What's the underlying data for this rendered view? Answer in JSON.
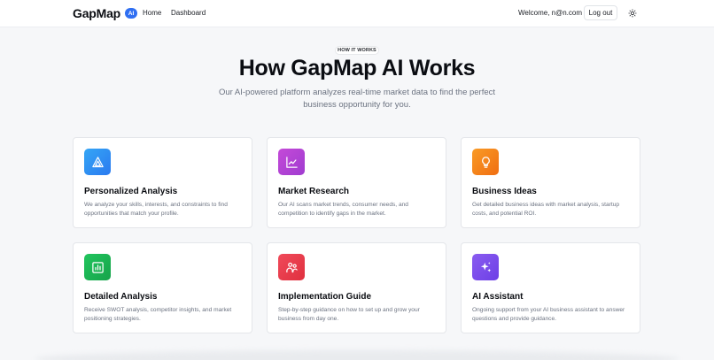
{
  "nav": {
    "brand": "GapMap",
    "badge": "AI",
    "links": [
      "Home",
      "Dashboard"
    ],
    "welcome": "Welcome, n@n.com",
    "logout": "Log out",
    "theme_icon": "sun-icon"
  },
  "hero": {
    "pill": "HOW IT WORKS",
    "title": "How GapMap AI Works",
    "subtitle": "Our AI-powered platform analyzes real-time market data to find the perfect business opportunity for you."
  },
  "cards": [
    {
      "title": "Personalized Analysis",
      "desc": "We analyze your skills, interests, and constraints to find opportunities that match your profile.",
      "icon": "triangle-icon",
      "color_from": "#35a6f5",
      "color_to": "#2a7af0"
    },
    {
      "title": "Market Research",
      "desc": "Our AI scans market trends, consumer needs, and competition to identify gaps in the market.",
      "icon": "line-chart-icon",
      "color_from": "#c44ad8",
      "color_to": "#a03cd0"
    },
    {
      "title": "Business Ideas",
      "desc": "Get detailed business ideas with market analysis, startup costs, and potential ROI.",
      "icon": "lightbulb-icon",
      "color_from": "#f99b26",
      "color_to": "#f06e12"
    },
    {
      "title": "Detailed Analysis",
      "desc": "Receive SWOT analysis, competitor insights, and market positioning strategies.",
      "icon": "bar-chart-icon",
      "color_from": "#22c55e",
      "color_to": "#16a34a"
    },
    {
      "title": "Implementation Guide",
      "desc": "Step-by-step guidance on how to set up and grow your business from day one.",
      "icon": "users-icon",
      "color_from": "#f04a5a",
      "color_to": "#e0303f"
    },
    {
      "title": "AI Assistant",
      "desc": "Ongoing support from your AI business assistant to answer questions and provide guidance.",
      "icon": "sparkles-icon",
      "color_from": "#8a5cf0",
      "color_to": "#6d3fe6"
    }
  ]
}
